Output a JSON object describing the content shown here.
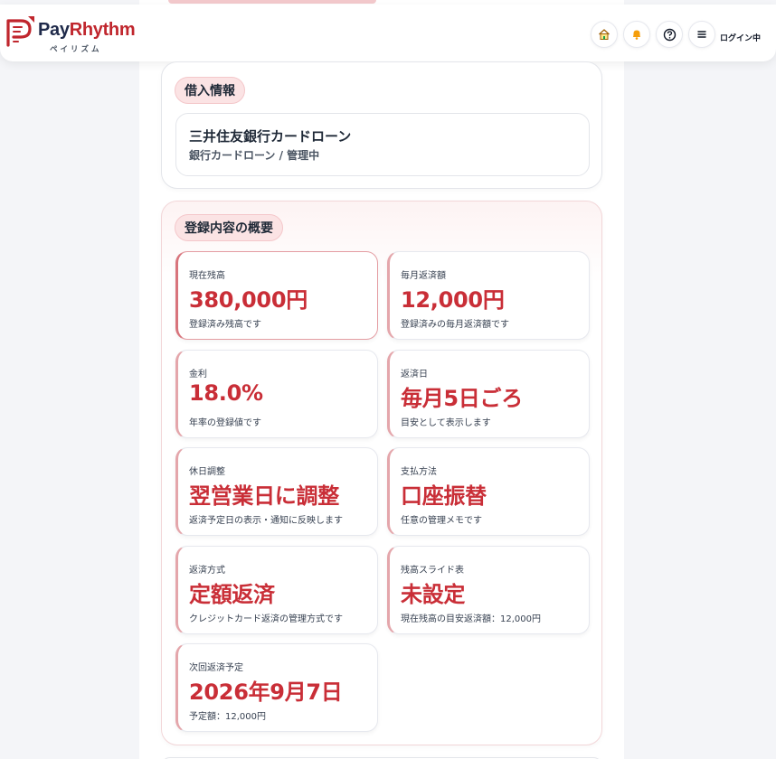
{
  "brand": {
    "name_part1": "Pay",
    "name_part2": "Rhythm",
    "subtitle": "ペイリズム",
    "accent_color": "#c0262d",
    "navy_color": "#1f2a4a"
  },
  "header": {
    "icons": [
      "home-icon",
      "bell-icon",
      "help-icon",
      "menu-icon"
    ],
    "login_status": "ログイン中"
  },
  "borrow_info": {
    "heading": "借入情報",
    "loan_name": "三井住友銀行カードローン",
    "loan_detail": "銀行カードローン / 管理中"
  },
  "summary": {
    "heading": "登録内容の概要",
    "tiles": [
      {
        "label": "現在残高",
        "value": "380,000円",
        "note": "登録済み残高です"
      },
      {
        "label": "毎月返済額",
        "value": "12,000円",
        "note": "登録済みの毎月返済額です"
      },
      {
        "label": "金利",
        "value": "18.0%",
        "note": "年率の登録値です"
      },
      {
        "label": "返済日",
        "value": "毎月5日ごろ",
        "note": "目安として表示します"
      },
      {
        "label": "休日調整",
        "value": "翌営業日に調整",
        "note": "返済予定日の表示・通知に反映します"
      },
      {
        "label": "支払方法",
        "value": "口座振替",
        "note": "任意の管理メモです"
      },
      {
        "label": "返済方式",
        "value": "定額返済",
        "note": "クレジットカード返済の管理方式です"
      },
      {
        "label": "残高スライド表",
        "value": "未設定",
        "note": "現在残高の目安返済額：12,000円"
      },
      {
        "label": "次回返済予定",
        "value": "2026年9月7日",
        "note": "予定額：12,000円"
      }
    ]
  }
}
